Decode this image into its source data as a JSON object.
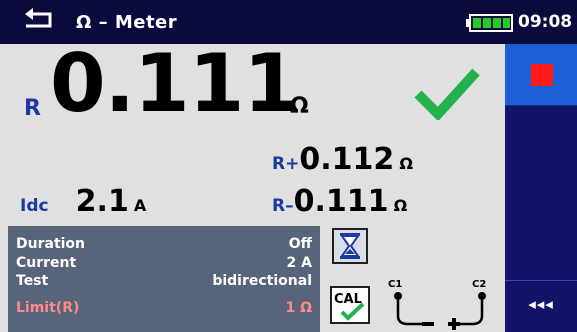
{
  "header": {
    "title": "Ω – Meter",
    "clock": "09:08"
  },
  "main_result": {
    "symbol": "R",
    "value": "0.111",
    "unit": "Ω",
    "status": "pass"
  },
  "sub_results": {
    "rplus": {
      "symbol": "R+",
      "value": "0.112",
      "unit": "Ω"
    },
    "rminus": {
      "symbol": "R–",
      "value": "0.111",
      "unit": "Ω"
    },
    "idc": {
      "label": "Idc",
      "value": "2.1",
      "unit": "A"
    }
  },
  "parameters": [
    {
      "label": "Duration",
      "value": "Off"
    },
    {
      "label": "Current",
      "value": "2 A"
    },
    {
      "label": "Test",
      "value": "bidirectional"
    },
    {
      "label": "Limit(R)",
      "value": "1 Ω"
    }
  ],
  "icons": {
    "cal": "CAL",
    "terminal_left": "C1",
    "terminal_right": "C2"
  },
  "sidebar": {
    "more_label": "◂◂◂"
  },
  "colors": {
    "titlebar": "#0a0a3c",
    "sidebar": "#13136a",
    "pass": "#22b14c",
    "stop": "#ff1a1a",
    "limit": "#ff8a8a"
  }
}
